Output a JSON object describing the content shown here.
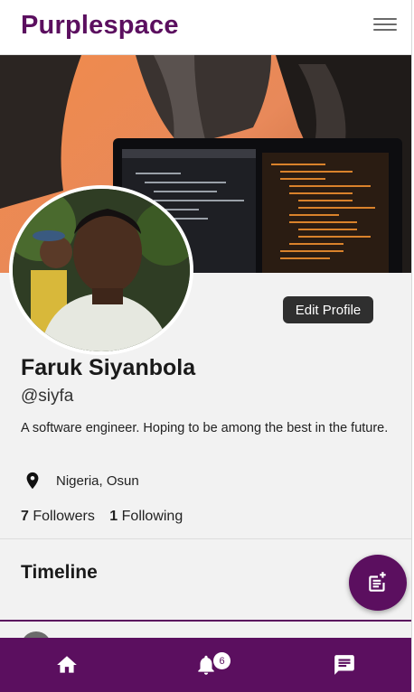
{
  "app": {
    "title": "Purplespace",
    "accent_color": "#5b0f5f"
  },
  "header": {
    "menu_icon": "hamburger-menu-icon"
  },
  "profile": {
    "edit_label": "Edit Profile",
    "name": "Faruk Siyanbola",
    "handle": "@siyfa",
    "bio": "A software engineer. Hoping to be among the best in the future.",
    "location": "Nigeria, Osun",
    "followers_count": "7",
    "followers_label": "Followers",
    "following_count": "1",
    "following_label": "Following"
  },
  "timeline": {
    "title": "Timeline",
    "fab_icon": "new-post-icon"
  },
  "bottom_nav": {
    "items": [
      {
        "icon": "home-icon"
      },
      {
        "icon": "bell-icon",
        "badge": "6"
      },
      {
        "icon": "chat-icon"
      }
    ]
  }
}
